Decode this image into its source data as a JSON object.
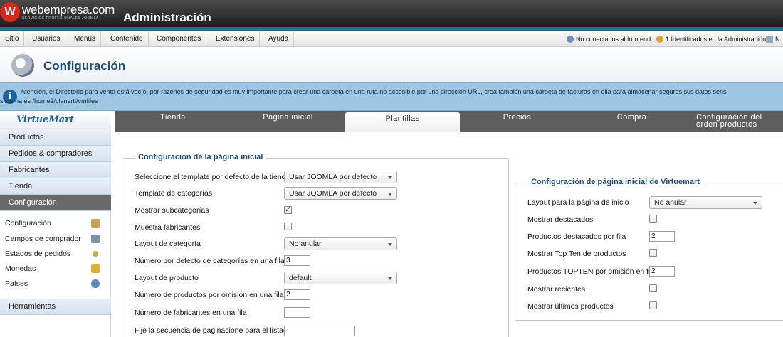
{
  "header": {
    "logo_name": "webempresa.com",
    "logo_sub": "SERVICIOS PROFESIONALES JOOMLA",
    "title": "Administración"
  },
  "menu": [
    {
      "label": "Sitio"
    },
    {
      "label": "Usuarios"
    },
    {
      "label": "Menús"
    },
    {
      "label": "Contenido"
    },
    {
      "label": "Componentes"
    },
    {
      "label": "Extensiones"
    },
    {
      "label": "Ayuda"
    }
  ],
  "status": {
    "frontend": "No conectados al frontend",
    "admin": "1 Identificados en la Administración",
    "extra": "N"
  },
  "toolbar": {
    "title": "Configuración"
  },
  "notice": {
    "line1": "Atención, el Directorio para venta está vacío, por razones de seguridad es muy importante para crear una carpeta en una ruta no accesible por una dirección URL, crea también una carpeta de facturas en ella para almacenar seguros sus datos sens",
    "line2": "sistema es /home2/clenerti/vmfiles"
  },
  "sidebar": {
    "logo": "VirtueMart",
    "items": [
      {
        "label": "Productos"
      },
      {
        "label": "Pedidos & compradores"
      },
      {
        "label": "Fabricantes"
      },
      {
        "label": "Tienda"
      },
      {
        "label": "Configuración"
      }
    ],
    "subitems": [
      {
        "label": "Configuración",
        "icon": "tools-icon",
        "color": "#c9a15a"
      },
      {
        "label": "Campos de comprador",
        "icon": "form-icon",
        "color": "#7d8fa6"
      },
      {
        "label": "Estados de pedidos",
        "icon": "status-icon",
        "color": "#d9a23b"
      },
      {
        "label": "Monedas",
        "icon": "coins-icon",
        "color": "#e0b030"
      },
      {
        "label": "Países",
        "icon": "globe-icon",
        "color": "#5c86b8"
      }
    ],
    "tools": "Herramientas"
  },
  "tabs": [
    {
      "label": "Tienda"
    },
    {
      "label": "Pagina inicial"
    },
    {
      "label": "Plantillas"
    },
    {
      "label": "Precios"
    },
    {
      "label": "Compra"
    },
    {
      "label": "Configuración del orden productos"
    }
  ],
  "left_panel": {
    "legend": "Configuración de la página inicial",
    "rows": [
      {
        "label": "Seleccione el template por defecto de la tienda",
        "value": "Usar JOOMLA por defecto"
      },
      {
        "label": "Template de categorías",
        "value": "Usar JOOMLA por defecto"
      },
      {
        "label": "Mostrar subcategorías",
        "checked": true
      },
      {
        "label": "Muestra fabricantes",
        "checked": false
      },
      {
        "label": "Layout de categoría",
        "value": "No anular"
      },
      {
        "label": "Número por defecto de categorías en una fila",
        "value": "3"
      },
      {
        "label": "Layout de producto",
        "value": "default"
      },
      {
        "label": "Número de productos por omisión en una fila",
        "value": "2"
      },
      {
        "label": "Número de fabricantes en una fila",
        "value": ""
      },
      {
        "label": "Fije la secuencia de paginacione para el listado",
        "value": ""
      }
    ]
  },
  "right_panel": {
    "legend": "Configuración de página inicial de Virtuemart",
    "rows": [
      {
        "label": "Layout para la página de inicio",
        "value": "No anular"
      },
      {
        "label": "Mostrar destacados",
        "checked": false
      },
      {
        "label": "Productos destacados por fila",
        "value": "2"
      },
      {
        "label": "Mostrar Top Ten de productos",
        "checked": false
      },
      {
        "label": "Productos TOPTEN por omisión en fila",
        "value": "2"
      },
      {
        "label": "Mostrar recientes",
        "checked": false
      },
      {
        "label": "Mostrar últimos productos",
        "checked": false
      }
    ]
  }
}
